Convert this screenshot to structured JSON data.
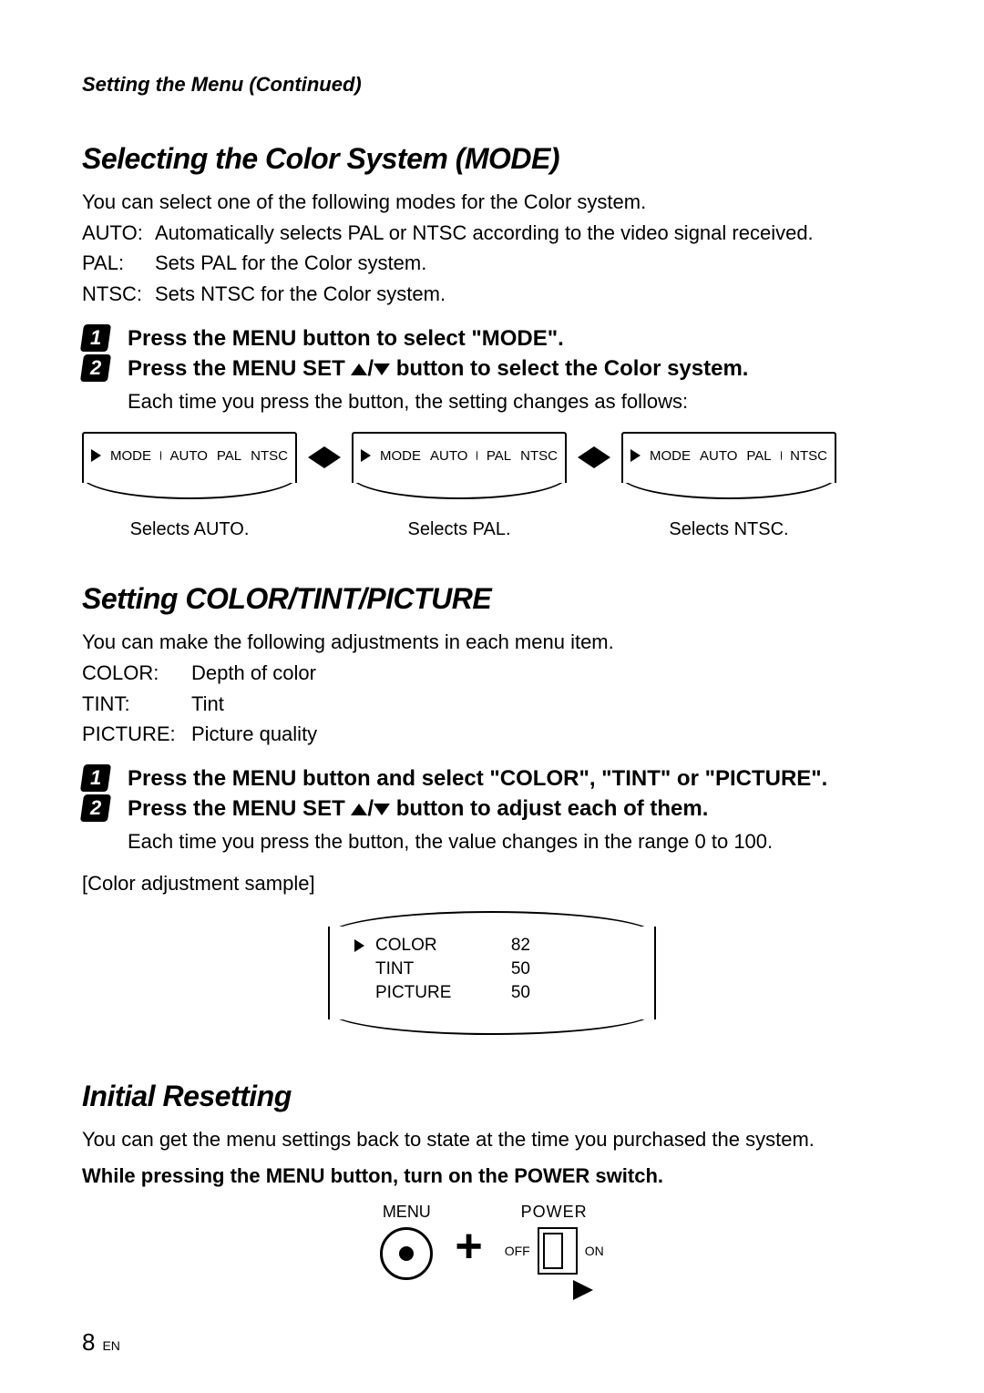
{
  "breadcrumb": "Setting the Menu (Continued)",
  "section1": {
    "heading": "Selecting the Color System (MODE)",
    "intro": "You can select one of the following modes for the Color system.",
    "modes": {
      "auto_label": "AUTO:",
      "auto_desc": "Automatically selects PAL or NTSC according to the video signal received.",
      "pal_label": "PAL:",
      "pal_desc": "Sets PAL for the Color system.",
      "ntsc_label": "NTSC:",
      "ntsc_desc": "Sets NTSC for the Color system."
    },
    "step1": "Press the MENU button to select \"MODE\".",
    "step2_pre": "Press the MENU SET ",
    "step2_post": " button to select the Color system.",
    "step2_note": "Each time you press the button, the setting changes as follows:",
    "diagram": {
      "mode_label": "MODE",
      "auto": "AUTO",
      "pal": "PAL",
      "ntsc": "NTSC",
      "caption_auto": "Selects AUTO.",
      "caption_pal": "Selects PAL.",
      "caption_ntsc": "Selects NTSC."
    }
  },
  "section2": {
    "heading": "Setting COLOR/TINT/PICTURE",
    "intro": "You can make the following adjustments in each menu item.",
    "items": {
      "color_label": "COLOR:",
      "color_desc": "Depth of color",
      "tint_label": "TINT:",
      "tint_desc": "Tint",
      "picture_label": "PICTURE:",
      "picture_desc": "Picture quality"
    },
    "step1": "Press the MENU button and select \"COLOR\", \"TINT\" or \"PICTURE\".",
    "step2_pre": "Press the MENU SET ",
    "step2_post": " button to adjust each of them.",
    "step2_note": "Each time you press the button, the value changes in the range 0 to 100.",
    "sample_label": "[Color adjustment sample]"
  },
  "chart_data": {
    "type": "table",
    "title": "Color adjustment sample",
    "rows": [
      {
        "name": "COLOR",
        "value": 82,
        "selected": true
      },
      {
        "name": "TINT",
        "value": 50,
        "selected": false
      },
      {
        "name": "PICTURE",
        "value": 50,
        "selected": false
      }
    ]
  },
  "section3": {
    "heading": "Initial Resetting",
    "intro": "You can get the menu settings back to state at the time you purchased the system.",
    "instruction": "While pressing the MENU button, turn on the POWER switch.",
    "diagram": {
      "menu": "MENU",
      "power": "POWER",
      "off": "OFF",
      "on": "ON"
    }
  },
  "footer": {
    "page": "8",
    "lang": "EN"
  }
}
